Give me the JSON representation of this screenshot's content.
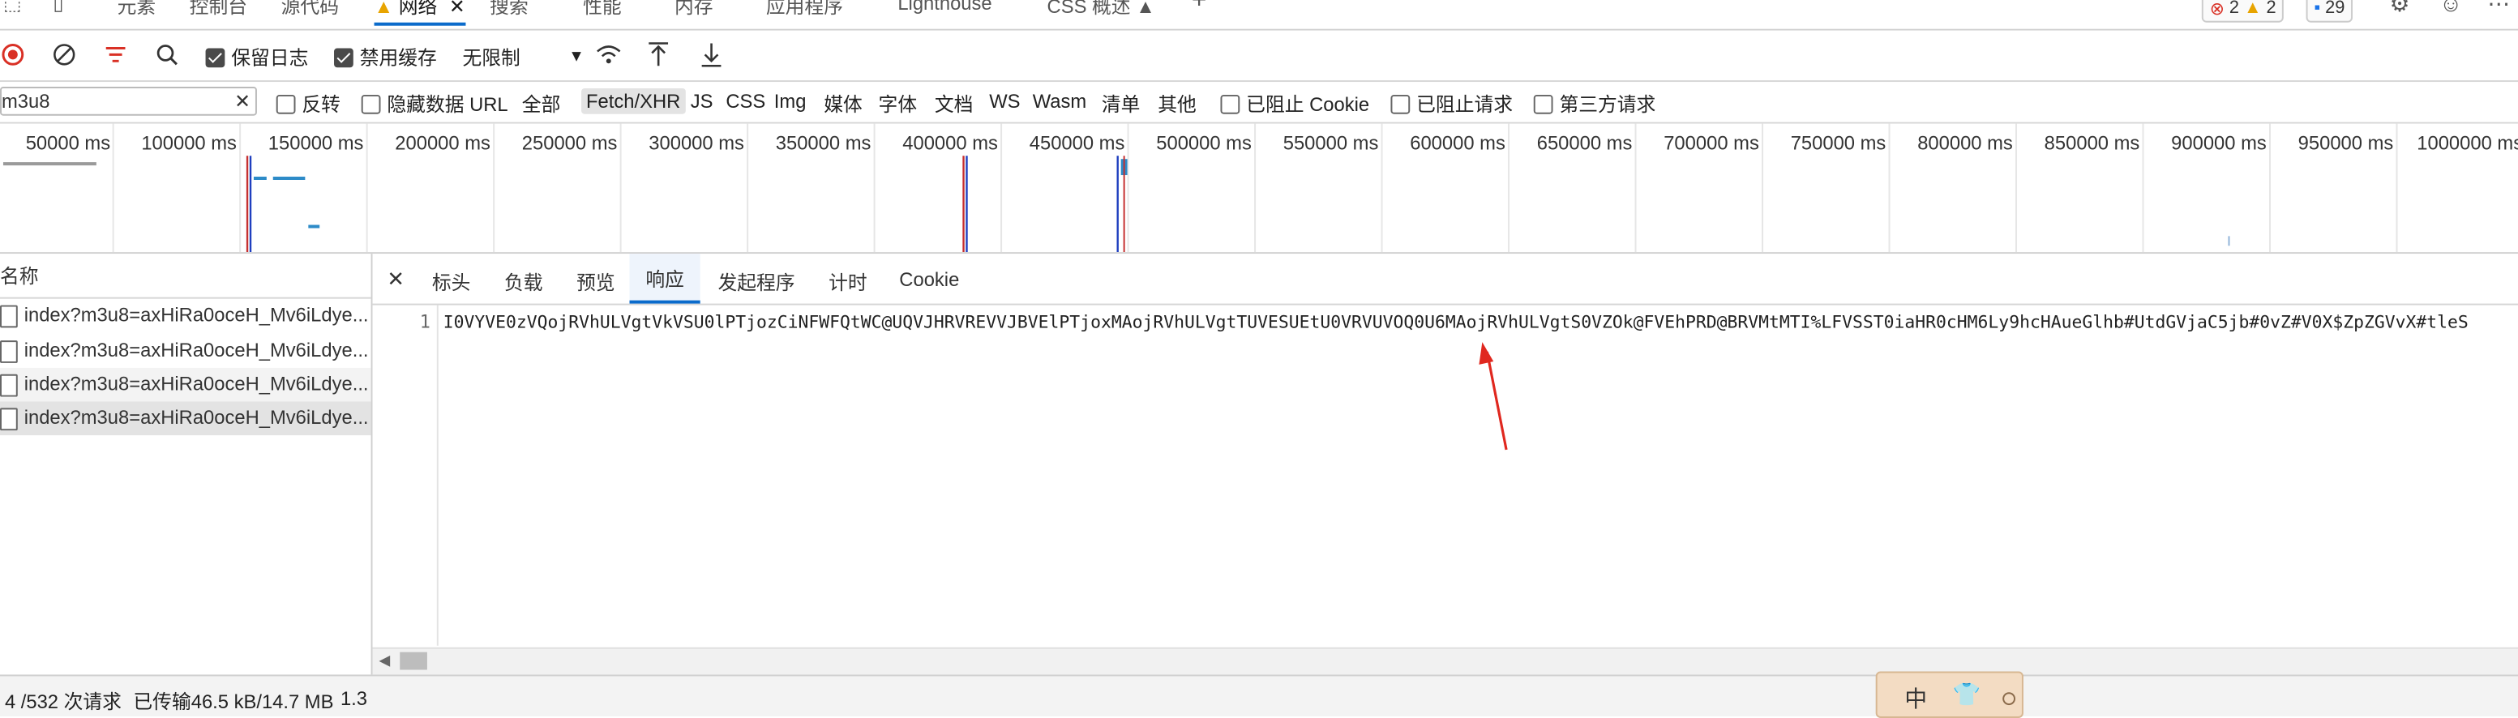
{
  "devtools_tabs": {
    "elements": "元素",
    "console": "控制台",
    "sources": "源代码",
    "network": "网络",
    "search": "搜索",
    "performance": "性能",
    "memory": "内存",
    "application": "应用程序",
    "lighthouse": "Lighthouse",
    "css_overview": "CSS 概述",
    "errors_count": "2",
    "warnings_count": "2",
    "messages_count": "29"
  },
  "toolbar": {
    "preserve_log": "保留日志",
    "disable_cache": "禁用缓存",
    "throttle_value": "无限制"
  },
  "filterbar": {
    "search_value": "m3u8",
    "invert": "反转",
    "hide_data_url": "隐藏数据 URL",
    "types": [
      "全部",
      "Fetch/XHR",
      "JS",
      "CSS",
      "Img",
      "媒体",
      "字体",
      "文档",
      "WS",
      "Wasm",
      "清单",
      "其他"
    ],
    "active_type": "Fetch/XHR",
    "blocked_cookies": "已阻止 Cookie",
    "blocked_requests": "已阻止请求",
    "third_party": "第三方请求"
  },
  "timeline": {
    "ticks": [
      "50000 ms",
      "100000 ms",
      "150000 ms",
      "200000 ms",
      "250000 ms",
      "300000 ms",
      "350000 ms",
      "400000 ms",
      "450000 ms",
      "500000 ms",
      "550000 ms",
      "600000 ms",
      "650000 ms",
      "700000 ms",
      "750000 ms",
      "800000 ms",
      "850000 ms",
      "900000 ms",
      "950000 ms",
      "1000000 ms"
    ]
  },
  "request_list": {
    "header": "名称",
    "rows": [
      "index?m3u8=axHiRa0oceH_Mv6iLdye...",
      "index?m3u8=axHiRa0oceH_Mv6iLdye...",
      "index?m3u8=axHiRa0oceH_Mv6iLdye...",
      "index?m3u8=axHiRa0oceH_Mv6iLdye..."
    ]
  },
  "detail_tabs": {
    "headers": "标头",
    "payload": "负载",
    "preview": "预览",
    "response": "响应",
    "initiator": "发起程序",
    "timing": "计时",
    "cookie": "Cookie"
  },
  "response": {
    "line_number": "1",
    "content": "I0VYVE0zVQojRVhULVgtVkVSU0lPTjozCiNFWFQtWC@UQVJHRVREVVJBVElPTjoxMAojRVhULVgtTUVESUEtU0VRVUVOQ0U6MAojRVhULVgtS0VZOk@FVEhPRD@BRVMtMTI%LFVSST0iaHR0cHM6Ly9hcHAueGlhb#UtdGVjaC5jb#0vZ#V0X$ZpZGVvX#tleS"
  },
  "status": {
    "requests": "4 /532 次请求",
    "transferred": "已传输46.5 kB/14.7 MB",
    "extra": "1.3"
  },
  "ime": {
    "label": "中"
  }
}
